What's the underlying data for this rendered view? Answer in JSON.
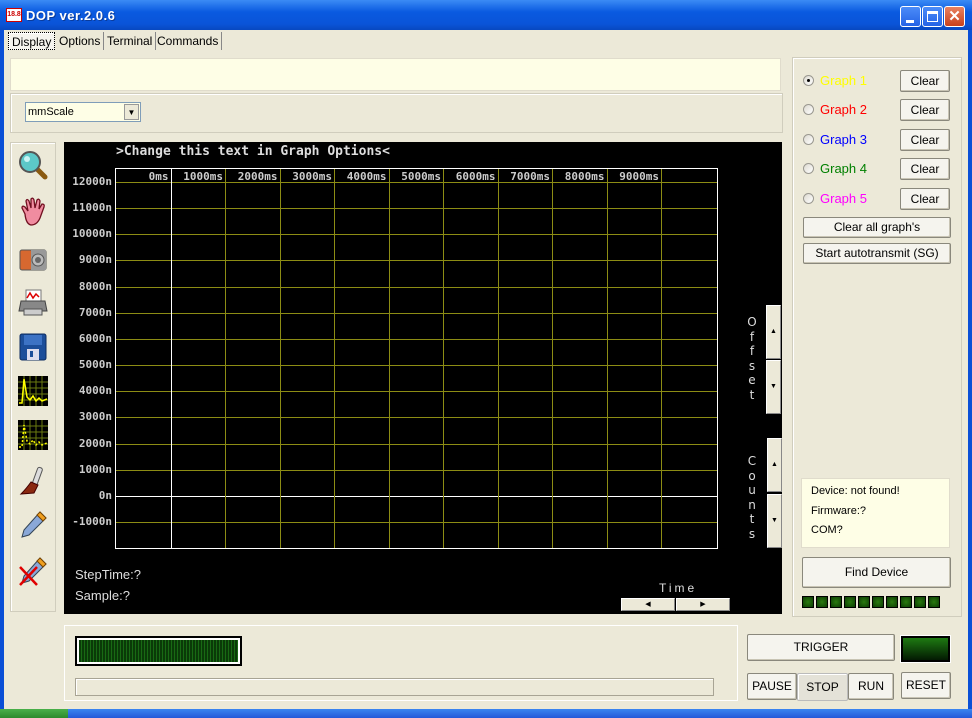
{
  "window": {
    "app_icon_text": "18.8",
    "title": "DOP  ver.2.0.6",
    "controls": {
      "minimize": "minimize-icon",
      "maximize": "maximize-icon",
      "close": "close-icon"
    }
  },
  "tabs": [
    {
      "label": "Display",
      "active": true
    },
    {
      "label": "Options",
      "active": false
    },
    {
      "label": "Terminal",
      "active": false
    },
    {
      "label": "Commands",
      "active": false
    }
  ],
  "message_box": "",
  "scale_select": {
    "value": "mmScale"
  },
  "toolbar": [
    {
      "name": "zoom-magnifier-icon"
    },
    {
      "name": "pan-hand-icon"
    },
    {
      "name": "camera-icon"
    },
    {
      "name": "printer-icon"
    },
    {
      "name": "floppy-save-icon"
    },
    {
      "name": "scope-waveform-icon"
    },
    {
      "name": "scope-waveform-dotted-icon"
    },
    {
      "name": "brush-icon"
    },
    {
      "name": "pen-icon"
    },
    {
      "name": "pen-disabled-icon"
    }
  ],
  "scope": {
    "title": ">Change this text in Graph Options<",
    "step_time": "StepTime:?",
    "sample": "Sample:?",
    "offset_label": "Offset",
    "counts_label": "Counts",
    "time_label": "Time"
  },
  "chart_data": {
    "type": "line",
    "title": ">Change this text in Graph Options<",
    "xlabel": "Time",
    "ylabel": "",
    "x_ticks": [
      "0ms",
      "1000ms",
      "2000ms",
      "3000ms",
      "4000ms",
      "5000ms",
      "6000ms",
      "7000ms",
      "8000ms",
      "9000ms"
    ],
    "y_ticks": [
      "12000n",
      "11000n",
      "10000n",
      "9000n",
      "8000n",
      "7000n",
      "6000n",
      "5000n",
      "4000n",
      "3000n",
      "2000n",
      "1000n",
      "0n",
      "-1000n"
    ],
    "x_range_ms": [
      0,
      10000
    ],
    "y_range": [
      -2000,
      12000
    ],
    "grid": true,
    "series": [],
    "colors": {
      "background": "#000000",
      "grid": "#8c8c14",
      "axis": "#ffffff",
      "label": "#cccccc"
    }
  },
  "graphs": [
    {
      "label": "Graph 1",
      "color": "#ffff00",
      "selected": true,
      "clear_label": "Clear"
    },
    {
      "label": "Graph 2",
      "color": "#ff0000",
      "selected": false,
      "clear_label": "Clear"
    },
    {
      "label": "Graph 3",
      "color": "#0000ff",
      "selected": false,
      "clear_label": "Clear"
    },
    {
      "label": "Graph 4",
      "color": "#008000",
      "selected": false,
      "clear_label": "Clear"
    },
    {
      "label": "Graph 5",
      "color": "#ff00ff",
      "selected": false,
      "clear_label": "Clear"
    }
  ],
  "clear_all_label": "Clear all graph's",
  "autotransmit_label": "Start autotransmit (SG)",
  "device": {
    "status": "Device: not found!",
    "firmware": "Firmware:?",
    "com": "COM?"
  },
  "find_device_label": "Find Device",
  "led_count": 10,
  "controls": {
    "trigger": "TRIGGER",
    "pause": "PAUSE",
    "stop": "STOP",
    "run": "RUN",
    "reset": "RESET"
  }
}
